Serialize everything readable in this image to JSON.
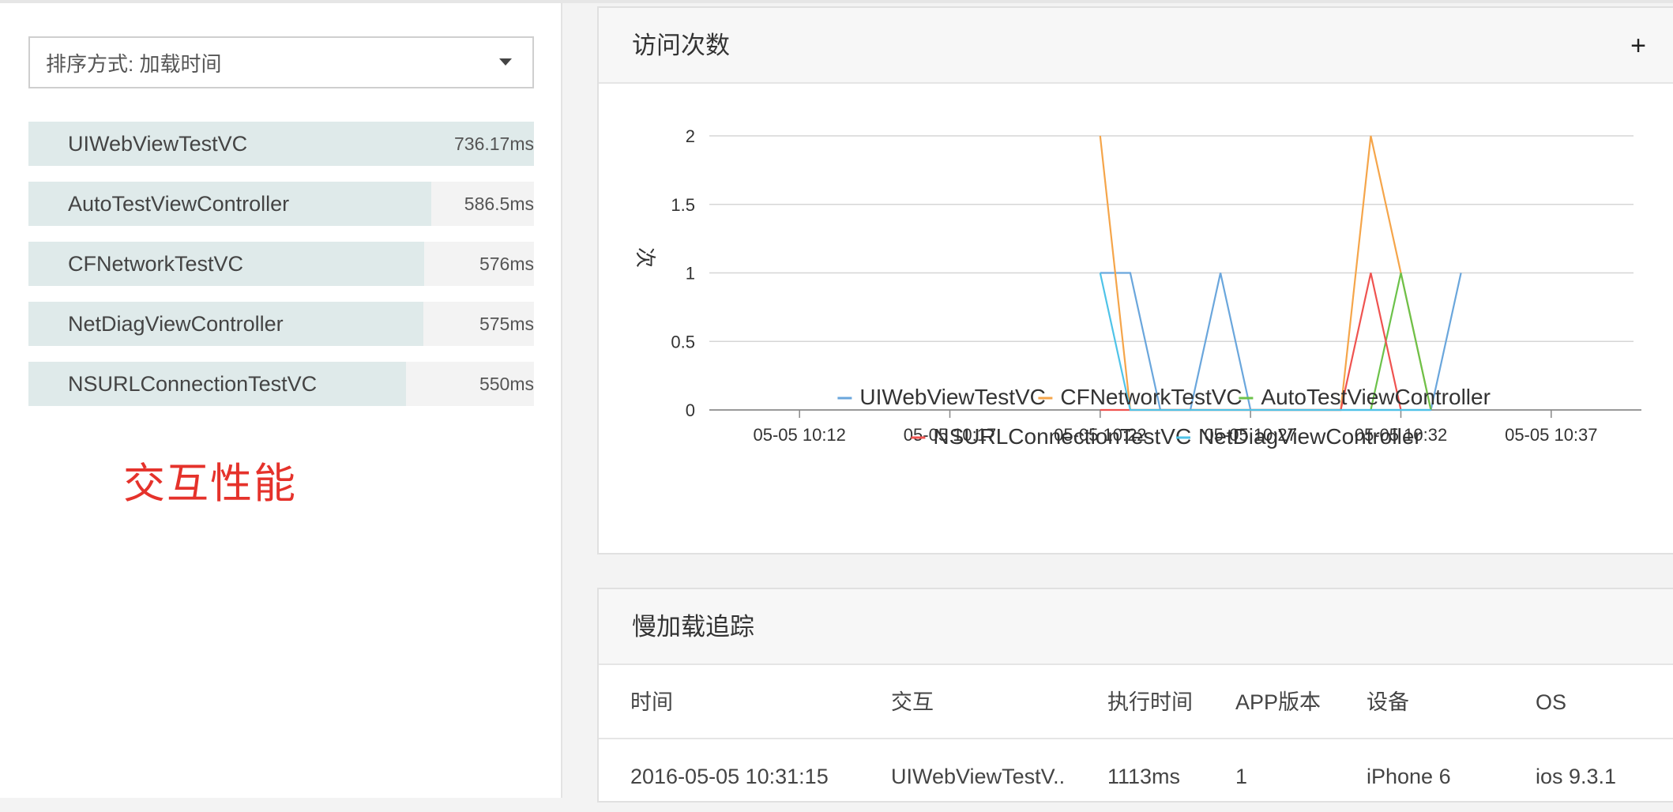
{
  "sort": {
    "label": "排序方式: 加载时间"
  },
  "ranking": [
    {
      "name": "UIWebViewTestVC",
      "value": "736.17ms",
      "ms": 736.17
    },
    {
      "name": "AutoTestViewController",
      "value": "586.5ms",
      "ms": 586.5
    },
    {
      "name": "CFNetworkTestVC",
      "value": "576ms",
      "ms": 576
    },
    {
      "name": "NetDiagViewController",
      "value": "575ms",
      "ms": 575
    },
    {
      "name": "NSURLConnectionTestVC",
      "value": "550ms",
      "ms": 550
    }
  ],
  "annotation": "交互性能",
  "visits_panel": {
    "title": "访问次数",
    "plus": "+"
  },
  "chart_data": {
    "type": "line",
    "title": "",
    "xlabel": "",
    "ylabel": "次",
    "ylim": [
      0,
      2
    ],
    "yticks": [
      0,
      0.5,
      1,
      1.5,
      2
    ],
    "ytick_labels": [
      "0",
      "0.5",
      "1",
      "1.5",
      "2"
    ],
    "xlim": [
      "05-05 10:09",
      "05-05 10:40"
    ],
    "xticks": [
      "05-05 10:12",
      "05-05 10:17",
      "05-05 10:22",
      "05-05 10:27",
      "05-05 10:32",
      "05-05 10:37"
    ],
    "grid": true,
    "legend_position": "bottom",
    "series": [
      {
        "name": "UIWebViewTestVC",
        "color": "#6aa6dc",
        "points": [
          [
            "05-05 10:22",
            1
          ],
          [
            "05-05 10:23",
            1
          ],
          [
            "05-05 10:24",
            0
          ],
          [
            "05-05 10:25",
            0
          ],
          [
            "05-05 10:26",
            1
          ],
          [
            "05-05 10:27",
            0
          ],
          [
            "05-05 10:31",
            0
          ],
          [
            "05-05 10:32",
            0
          ],
          [
            "05-05 10:33",
            0
          ],
          [
            "05-05 10:34",
            1
          ]
        ]
      },
      {
        "name": "CFNetworkTestVC",
        "color": "#f5a54a",
        "points": [
          [
            "05-05 10:22",
            2
          ],
          [
            "05-05 10:23",
            0
          ],
          [
            "05-05 10:30",
            0
          ],
          [
            "05-05 10:31",
            2
          ],
          [
            "05-05 10:32",
            1
          ],
          [
            "05-05 10:33",
            0
          ]
        ]
      },
      {
        "name": "AutoTestViewController",
        "color": "#6cc24a",
        "points": [
          [
            "05-05 10:31",
            0
          ],
          [
            "05-05 10:32",
            1
          ],
          [
            "05-05 10:33",
            0
          ]
        ]
      },
      {
        "name": "NSURLConnectionTestVC",
        "color": "#ef5350",
        "points": [
          [
            "05-05 10:22",
            0
          ],
          [
            "05-05 10:23",
            0
          ],
          [
            "05-05 10:30",
            0
          ],
          [
            "05-05 10:31",
            1
          ],
          [
            "05-05 10:32",
            0
          ]
        ]
      },
      {
        "name": "NetDiagViewController",
        "color": "#4fc3e8",
        "points": [
          [
            "05-05 10:22",
            1
          ],
          [
            "05-05 10:23",
            0
          ],
          [
            "05-05 10:31",
            0
          ],
          [
            "05-05 10:32",
            0
          ],
          [
            "05-05 10:33",
            0
          ]
        ]
      }
    ]
  },
  "slow_panel": {
    "title": "慢加载追踪",
    "columns": [
      "时间",
      "交互",
      "执行时间",
      "APP版本",
      "设备",
      "OS"
    ],
    "rows": [
      [
        "2016-05-05 10:31:15",
        "UIWebViewTestV..",
        "1113ms",
        "1",
        "iPhone 6",
        "ios 9.3.1"
      ]
    ]
  }
}
